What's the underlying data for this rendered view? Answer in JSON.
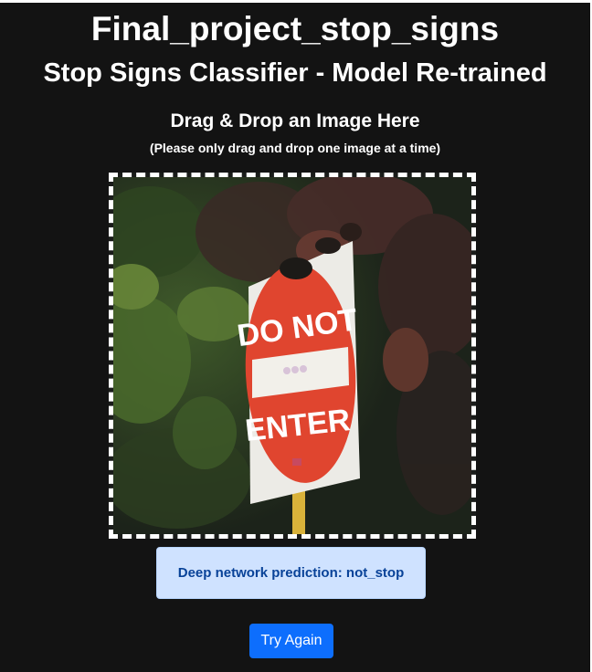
{
  "page": {
    "title": "Final_project_stop_signs",
    "subtitle": "Stop Signs Classifier - Model Re-trained"
  },
  "dropzone": {
    "heading": "Drag & Drop an Image Here",
    "note": "(Please only drag and drop one image at a time)",
    "image": {
      "sign_text_top": "DO NOT",
      "sign_text_bottom": "ENTER",
      "sign_color": "#e0452f"
    }
  },
  "result": {
    "prediction_text": "Deep network prediction: not_stop"
  },
  "actions": {
    "try_again_label": "Try Again"
  },
  "colors": {
    "background": "#131313",
    "alert_bg": "#cfe2ff",
    "alert_text": "#084298",
    "primary_button": "#0d6efd"
  }
}
